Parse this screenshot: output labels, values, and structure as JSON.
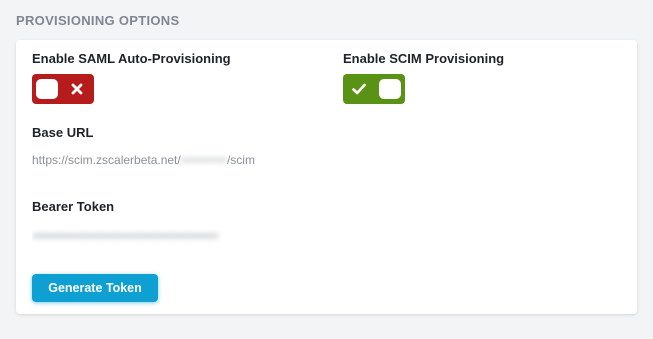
{
  "section": {
    "title": "PROVISIONING OPTIONS"
  },
  "saml": {
    "label": "Enable SAML Auto-Provisioning",
    "enabled": false
  },
  "scim": {
    "label": "Enable SCIM Provisioning",
    "enabled": true
  },
  "base_url": {
    "label": "Base URL",
    "prefix": "https://scim.zscalerbeta.net/",
    "redacted": "•••••••••••",
    "suffix": "/scim"
  },
  "bearer_token": {
    "label": "Bearer Token",
    "redacted_value": "••••••••••••••••••••••••••••••••••••••••••••••••••••••••••"
  },
  "actions": {
    "generate_label": "Generate Token"
  },
  "icons": {
    "off_icon": "x-icon",
    "on_icon": "check-icon"
  },
  "colors": {
    "toggle_off": "#b71c1c",
    "toggle_on": "#5a9216",
    "button": "#0e9fd3"
  }
}
